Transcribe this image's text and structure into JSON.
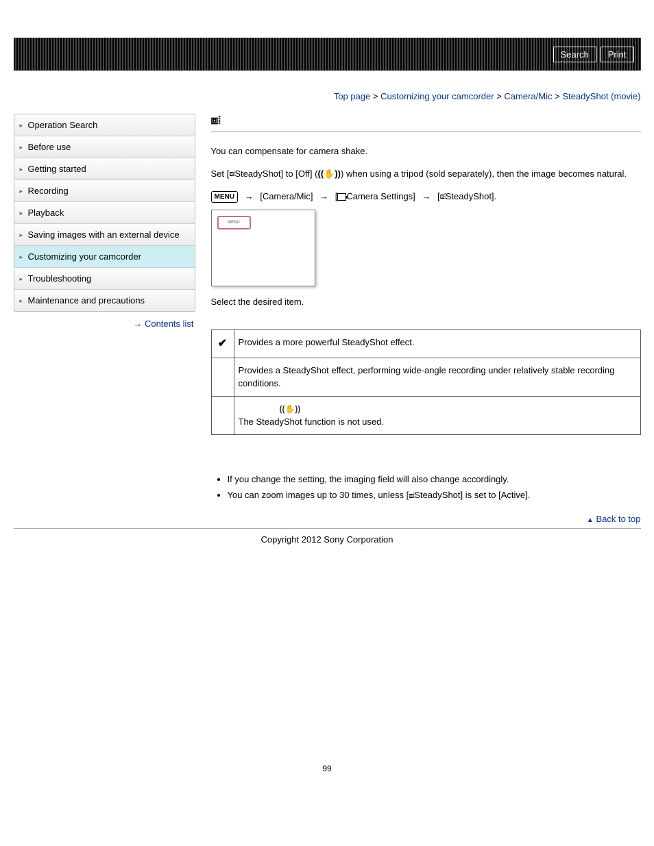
{
  "header": {
    "search": "Search",
    "print": "Print"
  },
  "breadcrumb": {
    "top": "Top page",
    "custom": "Customizing your camcorder",
    "cameramic": "Camera/Mic",
    "current": "SteadyShot (movie)"
  },
  "sidebar": {
    "items": [
      "Operation Search",
      "Before use",
      "Getting started",
      "Recording",
      "Playback",
      "Saving images with an external device",
      "Customizing your camcorder",
      "Troubleshooting",
      "Maintenance and precautions"
    ],
    "active_index": 6,
    "contents_list": "Contents list"
  },
  "main": {
    "intro1": "You can compensate for camera shake.",
    "intro2a": "Set [",
    "intro2b": "SteadyShot] to [Off] (",
    "intro2c": ") when using a tripod (sold separately), then the image becomes natural.",
    "path_item1": "[Camera/Mic]",
    "path_item2": "Camera Settings]",
    "path_item3": "SteadyShot].",
    "lcd_label": "MENU",
    "select_item": "Select the desired item.",
    "options": [
      {
        "default": true,
        "desc": "Provides a more powerful SteadyShot effect."
      },
      {
        "default": false,
        "desc": "Provides a SteadyShot effect, performing wide-angle recording under relatively stable recording conditions."
      },
      {
        "default": false,
        "desc": "The SteadyShot function is not used.",
        "icon": true
      }
    ],
    "notes": [
      "If you change the setting, the imaging field will also change accordingly.",
      "You can zoom images up to 30 times, unless [",
      "SteadyShot] is set to [Active]."
    ],
    "back_top": "Back to top"
  },
  "footer": {
    "copyright": "Copyright 2012 Sony Corporation",
    "page": "99"
  }
}
